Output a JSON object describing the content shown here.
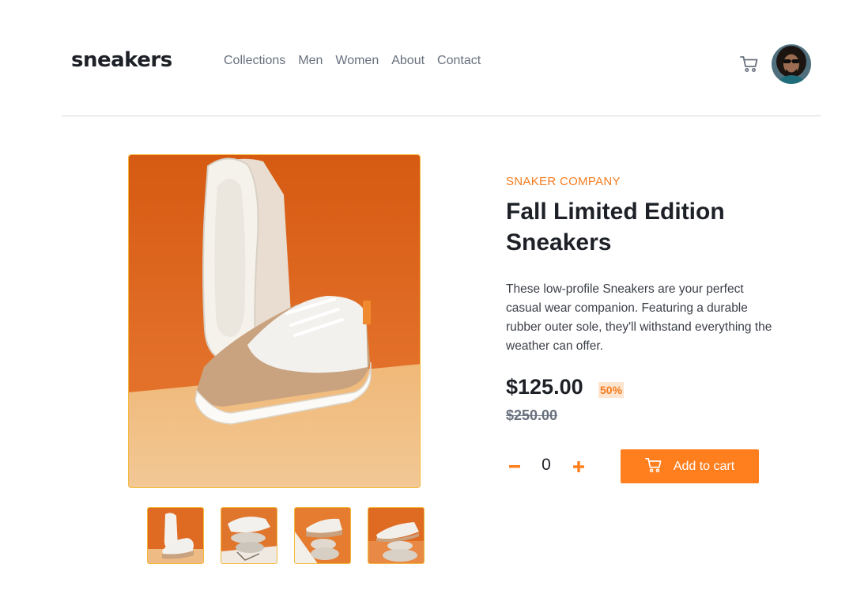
{
  "header": {
    "logo": "sneakers",
    "nav": [
      "Collections",
      "Men",
      "Women",
      "About",
      "Contact"
    ]
  },
  "product": {
    "company": "SNAKER COMPANY",
    "title": "Fall Limited Edition Sneakers",
    "description": "These low-profile Sneakers are your perfect casual wear companion. Featuring a durable rubber outer sole, they'll withstand everything the weather can offer.",
    "price": "$125.00",
    "discount": "50%",
    "old_price": "$250.00",
    "quantity": "0",
    "add_to_cart_label": "Add to cart"
  },
  "colors": {
    "accent": "#ff7f1f",
    "accent_light": "#fde5cf",
    "text_dark": "#1d2026",
    "text_muted": "#68707d"
  },
  "icons": [
    "cart-icon",
    "avatar",
    "minus-icon",
    "plus-icon"
  ]
}
